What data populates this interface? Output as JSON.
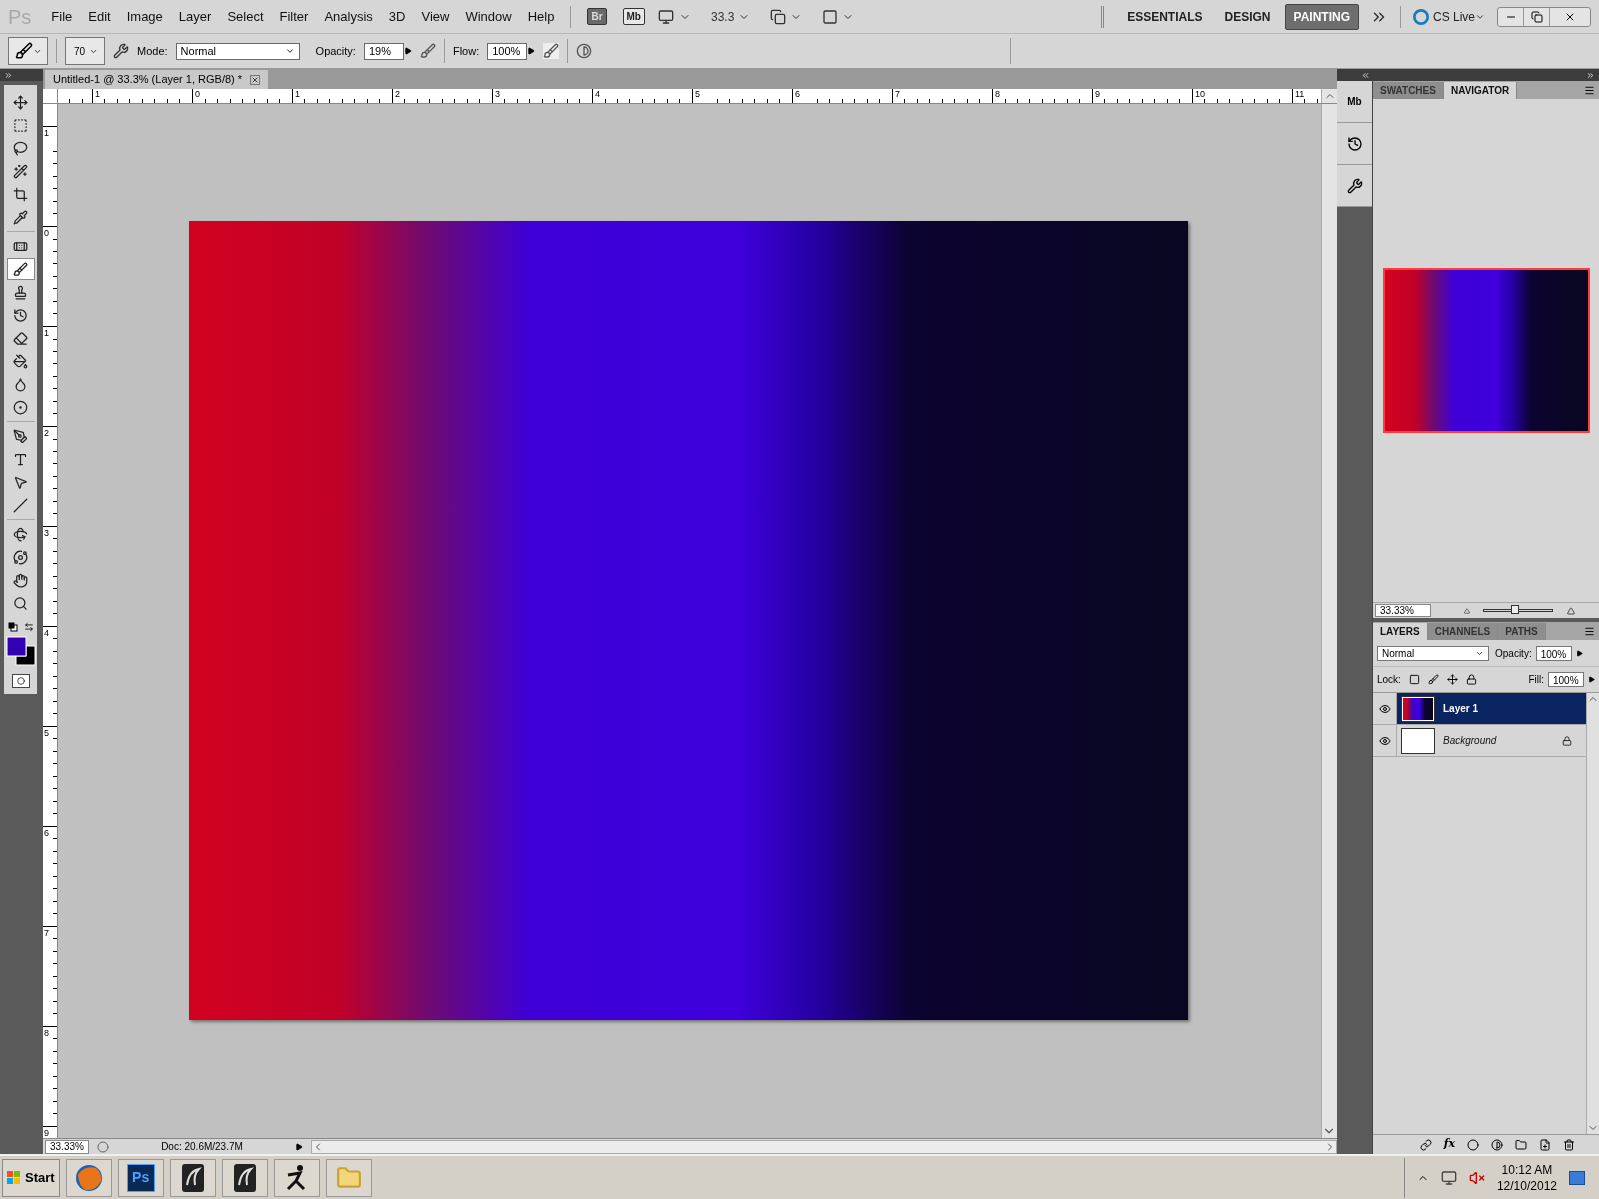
{
  "app_logo": "Ps",
  "menu": [
    "File",
    "Edit",
    "Image",
    "Layer",
    "Select",
    "Filter",
    "Analysis",
    "3D",
    "View",
    "Window",
    "Help"
  ],
  "app_bar": {
    "bridge": "Br",
    "mini_bridge": "Mb",
    "zoom": "33.3"
  },
  "workspaces": [
    {
      "label": "ESSENTIALS",
      "selected": false
    },
    {
      "label": "DESIGN",
      "selected": false
    },
    {
      "label": "PAINTING",
      "selected": true
    }
  ],
  "cs_live": "CS Live",
  "options": {
    "brush_size": "70",
    "mode_label": "Mode:",
    "mode": "Normal",
    "opacity_label": "Opacity:",
    "opacity": "19%",
    "flow_label": "Flow:",
    "flow": "100%"
  },
  "tool_groups": [
    {
      "tools": [
        {
          "kind": "move",
          "selected": false
        },
        {
          "kind": "marquee",
          "selected": false
        },
        {
          "kind": "lasso",
          "selected": false
        },
        {
          "kind": "quick-select",
          "selected": false
        },
        {
          "kind": "crop",
          "selected": false
        },
        {
          "kind": "eyedropper",
          "selected": false
        }
      ]
    },
    {
      "tools": [
        {
          "kind": "healing",
          "selected": false
        },
        {
          "kind": "brush",
          "selected": true
        },
        {
          "kind": "stamp",
          "selected": false
        },
        {
          "kind": "history-brush",
          "selected": false
        },
        {
          "kind": "eraser",
          "selected": false
        },
        {
          "kind": "bucket",
          "selected": false
        },
        {
          "kind": "blur",
          "selected": false
        },
        {
          "kind": "dodge",
          "selected": false
        }
      ]
    },
    {
      "tools": [
        {
          "kind": "pen",
          "selected": false
        },
        {
          "kind": "type",
          "selected": false
        },
        {
          "kind": "path-select",
          "selected": false
        },
        {
          "kind": "line",
          "selected": false
        }
      ]
    },
    {
      "tools": [
        {
          "kind": "rotate-3d",
          "selected": false
        },
        {
          "kind": "orbit-3d",
          "selected": false
        },
        {
          "kind": "hand",
          "selected": false
        },
        {
          "kind": "zoom",
          "selected": false
        }
      ]
    }
  ],
  "color_swatches": [
    {
      "kind": "foreground",
      "color": "#3300b4"
    },
    {
      "kind": "background",
      "color": "#000000"
    }
  ],
  "document": {
    "tab": "Untitled-1 @ 33.3% (Layer 1, RGB/8) *",
    "ruler_h": [
      "1",
      "0",
      "1",
      "2",
      "3",
      "4",
      "5",
      "6",
      "7",
      "8",
      "9",
      "10",
      "11"
    ],
    "ruler_v": [
      "1",
      "0",
      "1",
      "2",
      "3",
      "4",
      "5",
      "6",
      "7",
      "8",
      "9"
    ],
    "zoom": "33.33%",
    "doc_info": "Doc: 20.6M/23.7M"
  },
  "dock_icons": [
    {
      "kind": "mini-bridge",
      "label": "Mb"
    },
    {
      "kind": "history"
    },
    {
      "kind": "tools"
    }
  ],
  "navigator": {
    "tabs": [
      {
        "label": "SWATCHES",
        "selected": false
      },
      {
        "label": "NAVIGATOR",
        "selected": true
      }
    ],
    "zoom": "33.33%",
    "zoom_slider": {
      "level": 0.45
    }
  },
  "layers_panel": {
    "tabs": [
      {
        "label": "LAYERS",
        "selected": true
      },
      {
        "label": "CHANNELS",
        "selected": false
      },
      {
        "label": "PATHS",
        "selected": false
      }
    ],
    "blend_mode": "Normal",
    "opacity_label": "Opacity:",
    "opacity": "100%",
    "lock_label": "Lock:",
    "fill_label": "Fill:",
    "fill": "100%",
    "layers": [
      {
        "name": "Layer 1",
        "kind": "painted",
        "visible": true,
        "locked": false,
        "selected": true
      },
      {
        "name": "Background",
        "kind": "background",
        "visible": true,
        "locked": true,
        "selected": false
      }
    ],
    "style_button": "fx"
  },
  "taskbar": {
    "start": "Start",
    "apps": [
      {
        "kind": "browser"
      },
      {
        "kind": "photoshop",
        "label": "Ps"
      },
      {
        "kind": "dark-app"
      },
      {
        "kind": "dark-app"
      },
      {
        "kind": "figure"
      },
      {
        "kind": "folder"
      }
    ],
    "time": "10:12 AM",
    "date": "12/10/2012"
  }
}
